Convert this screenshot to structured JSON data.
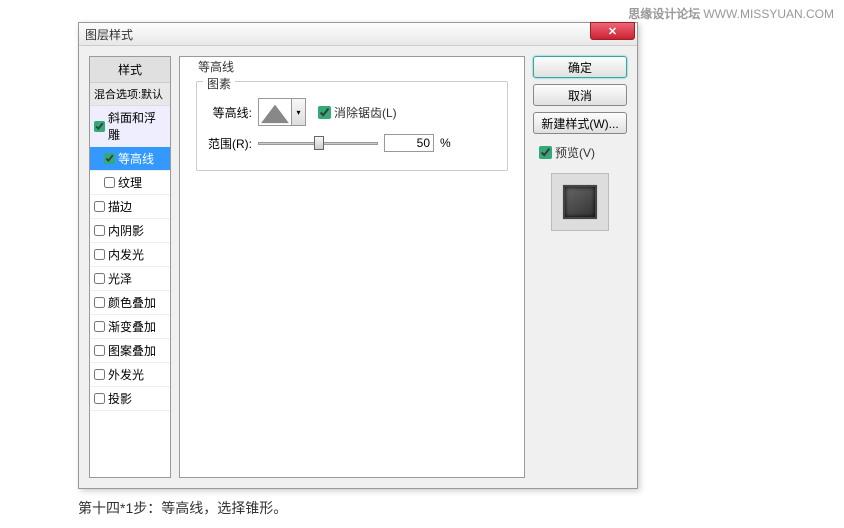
{
  "watermark": {
    "bold": "思缘设计论坛",
    "light": "WWW.MISSYUAN.COM"
  },
  "dialog": {
    "title": "图层样式",
    "close_x": "✕",
    "styles": {
      "header": "样式",
      "blend": "混合选项:默认",
      "items": [
        {
          "label": "斜面和浮雕",
          "checked": true,
          "indent": false,
          "selected": false
        },
        {
          "label": "等高线",
          "checked": true,
          "indent": true,
          "selected": true
        },
        {
          "label": "纹理",
          "checked": false,
          "indent": true,
          "selected": false
        },
        {
          "label": "描边",
          "checked": false,
          "indent": false,
          "selected": false
        },
        {
          "label": "内阴影",
          "checked": false,
          "indent": false,
          "selected": false
        },
        {
          "label": "内发光",
          "checked": false,
          "indent": false,
          "selected": false
        },
        {
          "label": "光泽",
          "checked": false,
          "indent": false,
          "selected": false
        },
        {
          "label": "颜色叠加",
          "checked": false,
          "indent": false,
          "selected": false
        },
        {
          "label": "渐变叠加",
          "checked": false,
          "indent": false,
          "selected": false
        },
        {
          "label": "图案叠加",
          "checked": false,
          "indent": false,
          "selected": false
        },
        {
          "label": "外发光",
          "checked": false,
          "indent": false,
          "selected": false
        },
        {
          "label": "投影",
          "checked": false,
          "indent": false,
          "selected": false
        }
      ]
    },
    "content": {
      "group_outer": "等高线",
      "group_inner": "图素",
      "contour_label": "等高线:",
      "antialias_label": "消除锯齿(L)",
      "range_label": "范围(R):",
      "range_value": "50",
      "range_unit": "%"
    },
    "buttons": {
      "ok": "确定",
      "cancel": "取消",
      "new_style": "新建样式(W)...",
      "preview": "预览(V)"
    }
  },
  "caption": "第十四*1步：等高线，选择锥形。"
}
